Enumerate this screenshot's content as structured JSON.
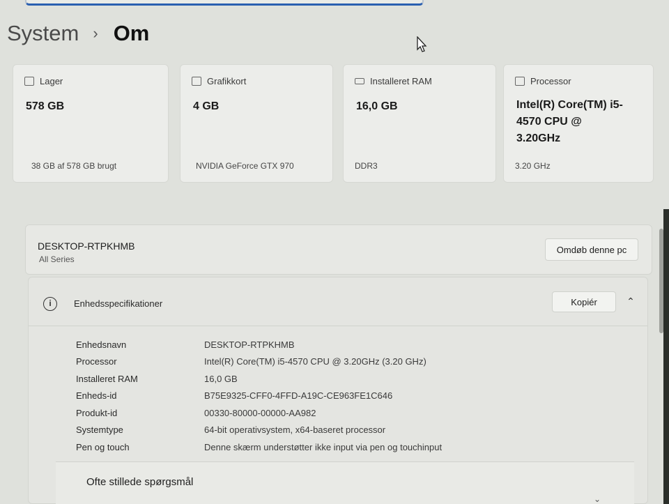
{
  "breadcrumb": {
    "parent": "System",
    "separator": "›",
    "current": "Om"
  },
  "cards": [
    {
      "label": "Lager",
      "value": "578 GB",
      "sub": "38 GB af 578 GB brugt",
      "icon": "storage-icon"
    },
    {
      "label": "Grafikkort",
      "value": "4 GB",
      "sub": "NVIDIA GeForce GTX 970",
      "icon": "graphics-card-icon"
    },
    {
      "label": "Installeret RAM",
      "value": "16,0 GB",
      "sub": "DDR3",
      "icon": "ram-icon"
    },
    {
      "label": "Processor",
      "value": "Intel(R) Core(TM) i5-4570 CPU @ 3.20GHz",
      "sub": "3.20 GHz",
      "icon": "processor-icon"
    }
  ],
  "device": {
    "name": "DESKTOP-RTPKHMB",
    "subtitle": "All Series",
    "rename_label": "Omdøb denne pc"
  },
  "specs": {
    "title": "Enhedsspecifikationer",
    "copy_label": "Kopiér",
    "rows": [
      {
        "label": "Enhedsnavn",
        "value": "DESKTOP-RTPKHMB"
      },
      {
        "label": "Processor",
        "value": "Intel(R) Core(TM) i5-4570 CPU @ 3.20GHz (3.20 GHz)"
      },
      {
        "label": "Installeret RAM",
        "value": "16,0 GB"
      },
      {
        "label": "Enheds-id",
        "value": "B75E9325-CFF0-4FFD-A19C-CE963FE1C646"
      },
      {
        "label": "Produkt-id",
        "value": "00330-80000-00000-AA982"
      },
      {
        "label": "Systemtype",
        "value": "64-bit operativsystem, x64-baseret processor"
      },
      {
        "label": "Pen og touch",
        "value": "Denne skærm understøtter ikke input via pen og touchinput"
      }
    ]
  },
  "faq": {
    "title": "Ofte stillede spørgsmål"
  },
  "colors": {
    "accent": "#2a5fb0",
    "background": "#dfe1dc",
    "card": "#ecedea"
  }
}
